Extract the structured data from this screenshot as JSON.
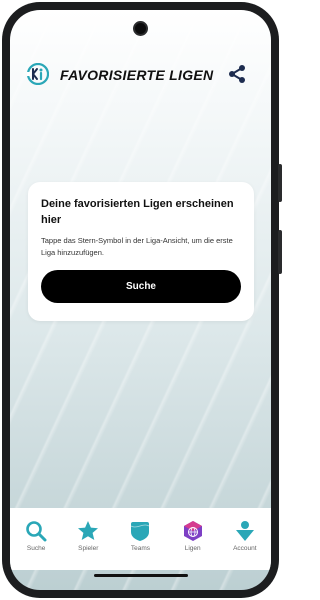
{
  "header": {
    "title": "FAVORISIERTE LIGEN",
    "logo_icon": "brand-logo-icon",
    "share_icon": "share-icon"
  },
  "empty_state": {
    "title": "Deine favorisierten Ligen erscheinen hier",
    "description": "Tappe das Stern-Symbol in der Liga-Ansicht, um die erste Liga hinzuzufügen.",
    "button_label": "Suche"
  },
  "tabbar": {
    "items": [
      {
        "label": "Suche",
        "icon": "search-icon"
      },
      {
        "label": "Spieler",
        "icon": "star-icon"
      },
      {
        "label": "Teams",
        "icon": "shield-icon"
      },
      {
        "label": "Ligen",
        "icon": "globe-icon"
      },
      {
        "label": "Account",
        "icon": "user-icon"
      }
    ],
    "active_index": 3
  },
  "colors": {
    "accent": "#2aa7b7",
    "brand_dark": "#1d2c4f",
    "ligen_purple": "#7d3fc5",
    "ligen_pink": "#d63b8f"
  }
}
